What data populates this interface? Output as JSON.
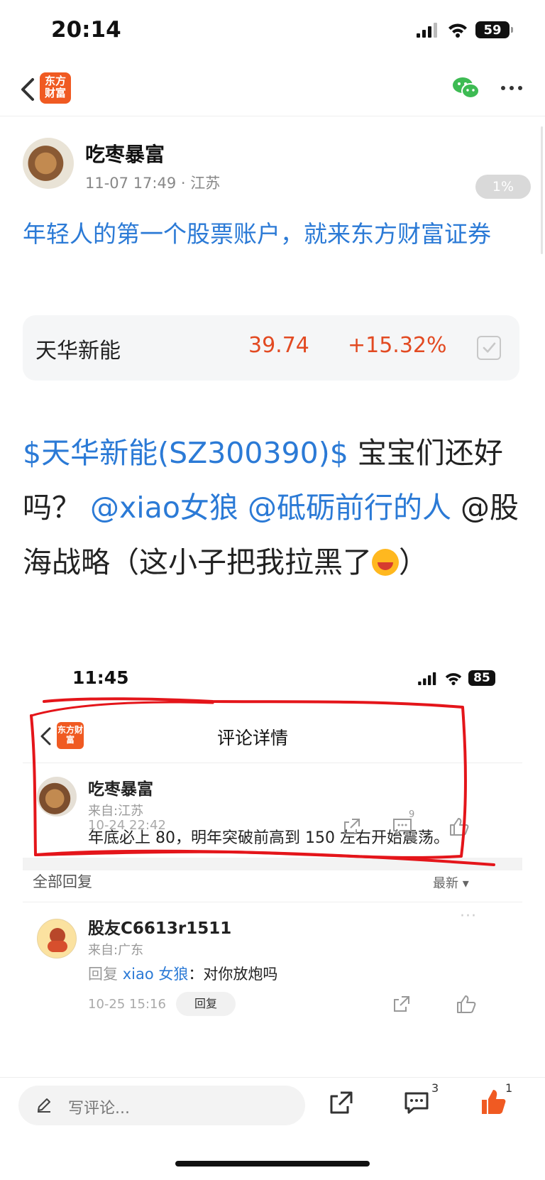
{
  "status_bar": {
    "time": "20:14",
    "battery": "59"
  },
  "nav": {
    "logo": "东方财富"
  },
  "author": {
    "name": "吃枣暴富",
    "meta": "11-07 17:49 · 江苏"
  },
  "progress": {
    "label": "1%",
    "value": 0.01
  },
  "post": {
    "title": "年轻人的第一个股票账户，就来东方财富证券",
    "body": {
      "stock_tag": "$天华新能(SZ300390)$",
      "text1": "宝宝们还好吗？",
      "mention1": "@xiao女狼",
      "mention2": "@砥砺前行的人",
      "text2": "@股海战略（这小子把我拉黑了",
      "text3": "）"
    }
  },
  "stock": {
    "name": "天华新能",
    "price": "39.74",
    "change": "+15.32%"
  },
  "embedded": {
    "time": "11:45",
    "battery": "85",
    "logo": "东方财富",
    "page_title": "评论详情",
    "main_comment": {
      "author": "吃枣暴富",
      "from": "来自:江苏",
      "text": "年底必上 80，明年突破前高到 150 左右开始震荡。",
      "date": "10-24 22:42",
      "reply_count": "9"
    },
    "all_replies_label": "全部回复",
    "sort_label": "最新",
    "reply": {
      "author": "股友C6613r1511",
      "from": "来自:广东",
      "prefix": "回复",
      "target": "xiao 女狼",
      "separator": "：",
      "text": "对你放炮吗",
      "date": "10-25 15:16",
      "reply_button": "回复",
      "more": "···"
    }
  },
  "bottom_bar": {
    "comment_placeholder": "写评论...",
    "comment_count": "3",
    "like_count": "1"
  },
  "colors": {
    "brand_orange": "#f05a22",
    "link_blue": "#2b7ad6",
    "price_red": "#e24a22",
    "marker_red": "#e4151a"
  }
}
